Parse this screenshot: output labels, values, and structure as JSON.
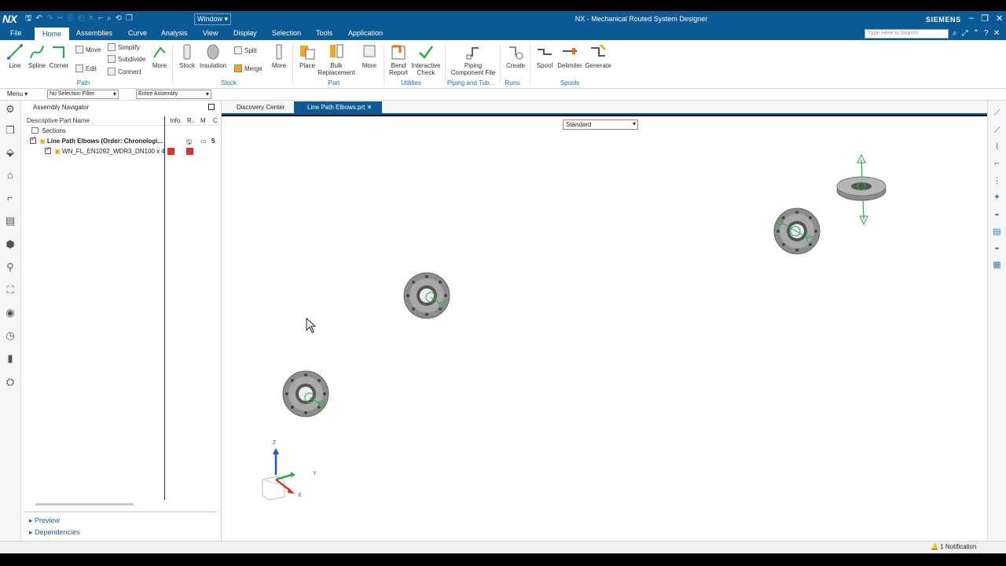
{
  "app": {
    "logo": "NX",
    "title": "NX - Mechanical Routed System Designer",
    "brand": "SIEMENS",
    "window_menu": "Window ▾"
  },
  "menu_tabs": [
    "File",
    "Home",
    "Assemblies",
    "Curve",
    "Analysis",
    "View",
    "Display",
    "Selection",
    "Tools",
    "Application"
  ],
  "active_tab": "Home",
  "search_placeholder": "Type Here to Search",
  "ribbon": {
    "path": {
      "line": "Line",
      "spline": "Spline",
      "corner": "Corner",
      "move": "Move",
      "edit": "Edit",
      "simplify": "Simplify",
      "subdivide": "Subdivide",
      "connect": "Connect",
      "more": "More",
      "label": "Path"
    },
    "stock": {
      "stock": "Stock",
      "insulation": "Insulation",
      "split": "Split",
      "merge": "Merge",
      "more": "More",
      "label": "Stock"
    },
    "part": {
      "place": "Place",
      "bulk": "Bulk Replacement",
      "more": "More",
      "label": "Part"
    },
    "utilities": {
      "bend": "Bend Report",
      "check": "Interactive Check",
      "label": "Utilities"
    },
    "piping": {
      "file": "Piping Component File",
      "label": "Piping and Tub..."
    },
    "runs": {
      "create": "Create",
      "label": "Runs"
    },
    "spools": {
      "spool": "Spool",
      "delimiter": "Delimiter",
      "generate": "Generate",
      "label": "Spools"
    }
  },
  "selection_bar": {
    "menu": "Menu ▾",
    "filter": "No Selection Filter",
    "scope": "Entire Assembly"
  },
  "navigator": {
    "title": "Assembly Navigator",
    "columns": [
      "Descriptive Part Name",
      "Info",
      "R..",
      "M",
      "C"
    ],
    "rows": [
      {
        "name": "Sections"
      },
      {
        "name": "Line Path Elbows (Order: Chronologi...",
        "count": "5"
      },
      {
        "name": "WN_FL_EN1092_WDR3_DN100 x 4"
      }
    ],
    "panels": [
      "Preview",
      "Dependencies"
    ]
  },
  "graphics": {
    "tabs": [
      "Discovery Center",
      "Line Path Elbows.prt"
    ],
    "active_tab": "Line Path Elbows.prt",
    "view_style": "Standard"
  },
  "triad": {
    "x": "X",
    "y": "Y",
    "z": "Z"
  },
  "status": {
    "notification": "1 Notification"
  },
  "colors": {
    "nx_blue": "#0b5a96",
    "link_blue": "#1a6fb3",
    "path_green": "#2aa84a"
  }
}
